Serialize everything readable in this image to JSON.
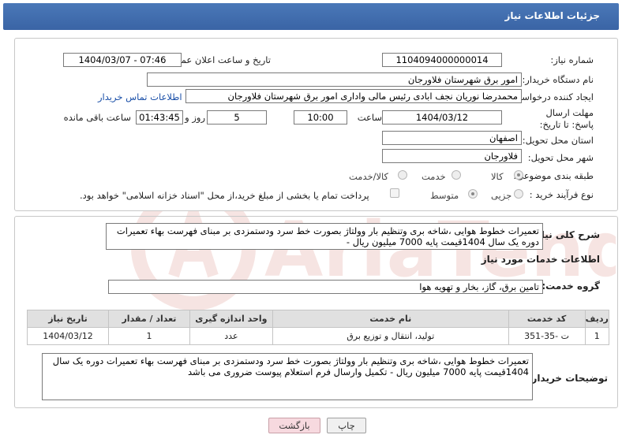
{
  "header": {
    "title": "جزئیات اطلاعات نیاز"
  },
  "fields": {
    "need_number_label": "شماره نیاز:",
    "need_number": "1104094000000014",
    "announce_label": "تاریخ و ساعت اعلان عمومی:",
    "announce_value": "1404/03/07 - 07:46",
    "buyer_org_label": "نام دستگاه خریدار:",
    "buyer_org": "امور برق شهرستان فلاورجان",
    "creator_label": "ایجاد کننده درخواست:",
    "creator": "محمدرضا نوریان نجف ابادی رئیس مالی واداری  امور برق شهرستان فلاورجان",
    "contact_link": "اطلاعات تماس خریدار",
    "deadline_label": "مهلت ارسال پاسخ: تا تاریخ:",
    "deadline_date": "1404/03/12",
    "time_label": "ساعت",
    "deadline_time": "10:00",
    "days_value": "5",
    "days_label": "روز و",
    "remaining_time": "01:43:45",
    "remaining_label": "ساعت باقی مانده",
    "province_label": "استان محل تحویل:",
    "province": "اصفهان",
    "city_label": "شهر محل تحویل:",
    "city": "فلاورجان",
    "category_label": "طبقه بندی موضوعی:",
    "category_options": [
      "کالا",
      "خدمت",
      "کالا/خدمت"
    ],
    "process_label": "نوع فرآیند خرید :",
    "process_options": [
      "جزیی",
      "متوسط"
    ],
    "payment_note": "پرداخت تمام یا بخشی از مبلغ خرید،از محل \"اسناد خزانه اسلامی\" خواهد بود."
  },
  "general_desc": {
    "label": "شرح کلی نیاز:",
    "text": "تعمیرات خطوط هوایی ،شاخه بری وتنظیم بار وولتاژ بصورت خط سرد  ودستمزدی بر مبنای فهرست بهاء تعمیرات دوره یک سال 1404قیمت پایه 7000 میلیون ریال -"
  },
  "services": {
    "section_title": "اطلاعات خدمات مورد نیاز",
    "group_label": "گروه خدمت:",
    "group_value": "تامین برق، گاز، بخار و تهویه هوا",
    "columns": [
      "ردیف",
      "کد خدمت",
      "نام خدمت",
      "واحد اندازه گیری",
      "تعداد / مقدار",
      "تاریخ نیاز"
    ],
    "rows": [
      [
        "1",
        "ت -35-351",
        "تولید، انتقال و توزیع برق",
        "عدد",
        "1",
        "1404/03/12"
      ]
    ]
  },
  "buyer_desc": {
    "label": "توضیحات خریدار:",
    "text": "تعمیرات خطوط هوایی ،شاخه بری وتنظیم بار وولتاژ بصورت خط سرد  ودستمزدی بر مبنای فهرست بهاء تعمیرات دوره یک سال 1404قیمت پایه 7000 میلیون ریال - تکمیل وارسال فرم استعلام پیوست ضروری می باشد"
  },
  "buttons": {
    "print": "چاپ",
    "back": "بازگشت"
  }
}
